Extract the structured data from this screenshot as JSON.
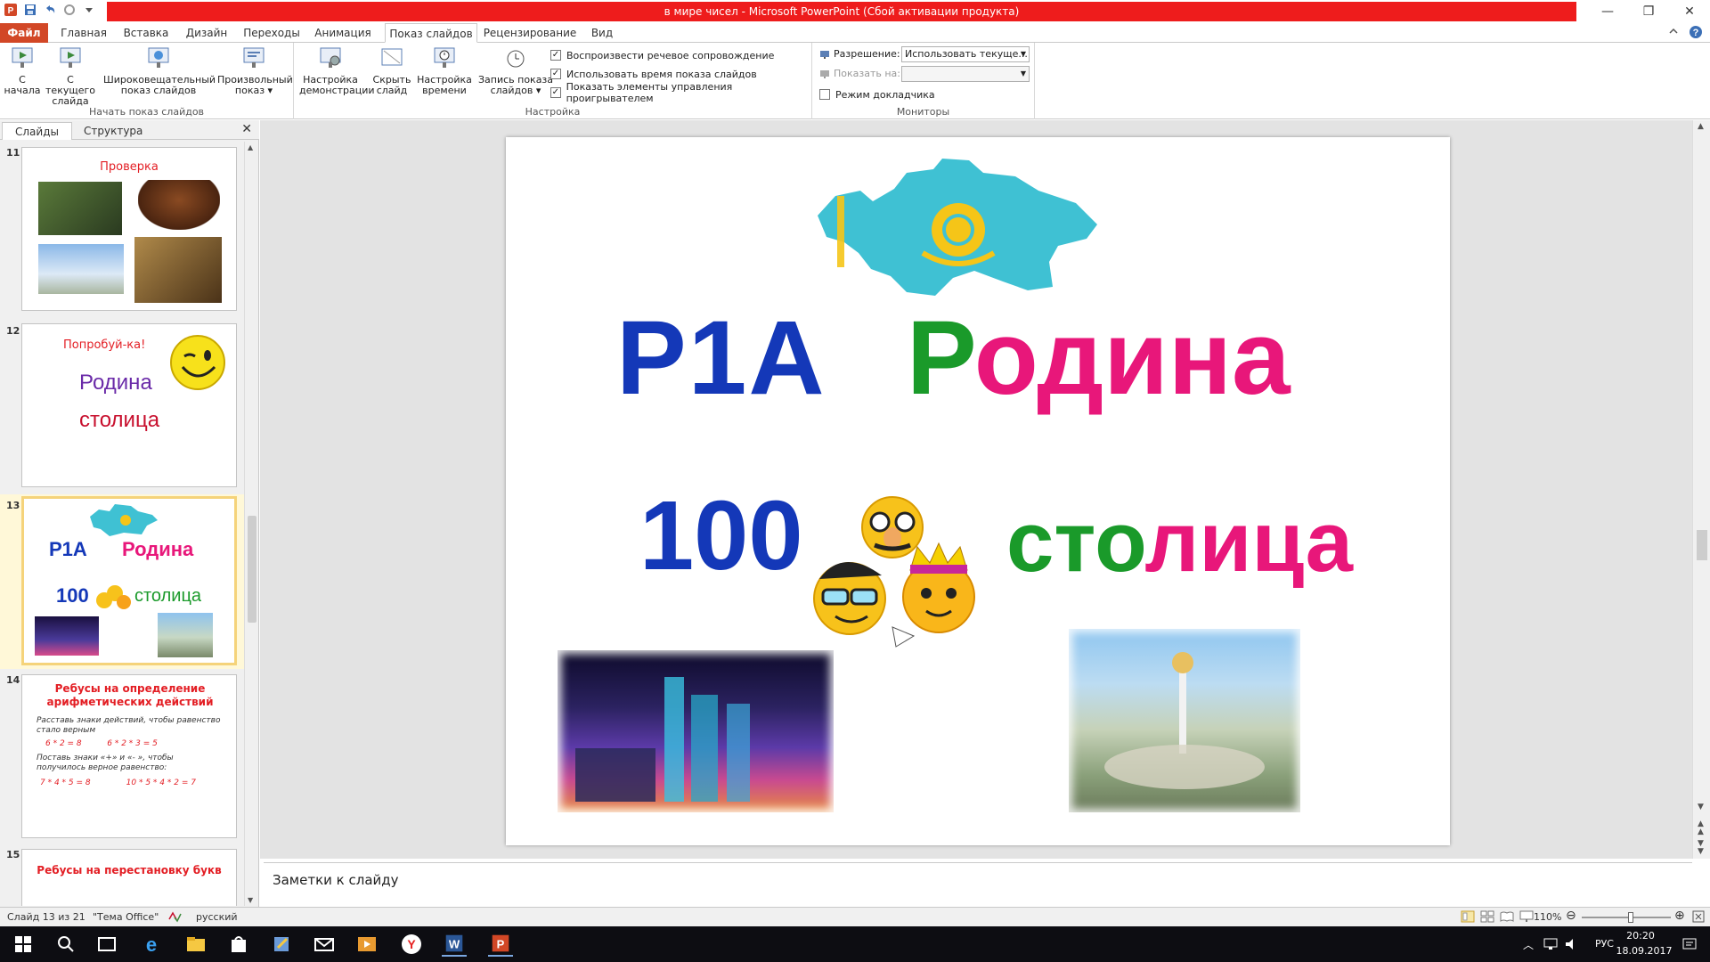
{
  "window": {
    "title": "в мире чисел  -  Microsoft PowerPoint (Сбой активации продукта)"
  },
  "ribbon": {
    "tabs": [
      "Файл",
      "Главная",
      "Вставка",
      "Дизайн",
      "Переходы",
      "Анимация",
      "Показ слайдов",
      "Рецензирование",
      "Вид"
    ],
    "active_tab": "Показ слайдов",
    "groups": {
      "start": {
        "label": "Начать показ слайдов",
        "buttons": [
          "С начала",
          "С текущего слайда",
          "Широковещательный показ слайдов",
          "Произвольный показ"
        ]
      },
      "setup": {
        "label": "Настройка",
        "buttons": [
          "Настройка демонстрации",
          "Скрыть слайд",
          "Настройка времени",
          "Запись показа слайдов"
        ],
        "checkboxes": [
          {
            "label": "Воспроизвести речевое сопровождение",
            "checked": true
          },
          {
            "label": "Использовать время показа слайдов",
            "checked": true
          },
          {
            "label": "Показать элементы управления проигрывателем",
            "checked": true
          }
        ]
      },
      "monitors": {
        "label": "Мониторы",
        "resolution_label": "Разрешение:",
        "resolution_value": "Использовать текуще...",
        "show_on_label": "Показать на:",
        "show_on_value": "",
        "presenter_view": "Режим докладчика"
      }
    }
  },
  "left_panel": {
    "tabs": [
      "Слайды",
      "Структура"
    ],
    "active_tab": "Слайды",
    "thumbnails": [
      {
        "num": "11",
        "title": "Проверка"
      },
      {
        "num": "12",
        "title": "Попробуй-ка!",
        "words": [
          "Родина",
          "столица"
        ]
      },
      {
        "num": "13",
        "words": [
          "Р1А",
          "Родина",
          "100",
          "столица"
        ],
        "selected": true
      },
      {
        "num": "14",
        "title": "Ребусы на определение арифметических  действий",
        "lines": [
          "Расставь знаки действий, чтобы равенство стало верным",
          "6 * 2 = 8          6 * 2 * 3 = 5",
          "Поставь знаки «+» и  «- », чтобы получилось верное равенство:",
          "7 * 4 * 5 = 8              10 * 5 * 4 * 2 = 7"
        ]
      },
      {
        "num": "15",
        "title": "Ребусы на перестановку букв"
      }
    ]
  },
  "slide": {
    "rebus1_left": "Р1А",
    "rebus1_right_first": "Р",
    "rebus1_right_rest": "одина",
    "rebus2_left": "100",
    "rebus2_right_a": "сто",
    "rebus2_right_b": "лица"
  },
  "notes": {
    "placeholder": "Заметки к слайду"
  },
  "status": {
    "slide_counter": "Слайд 13 из 21",
    "theme": "\"Тема Office\"",
    "language": "русский",
    "zoom": "110%"
  },
  "taskbar": {
    "lang": "РУС",
    "time": "20:20",
    "date": "18.09.2017"
  },
  "colors": {
    "powerpoint_accent": "#d24726",
    "title_bar_red": "#ee1c1c",
    "slide_blue": "#1438b8",
    "slide_green": "#1a9a2a",
    "slide_pink": "#e8177a",
    "kazakh_sky": "#3fc1d3",
    "kazakh_gold": "#f5c518"
  }
}
